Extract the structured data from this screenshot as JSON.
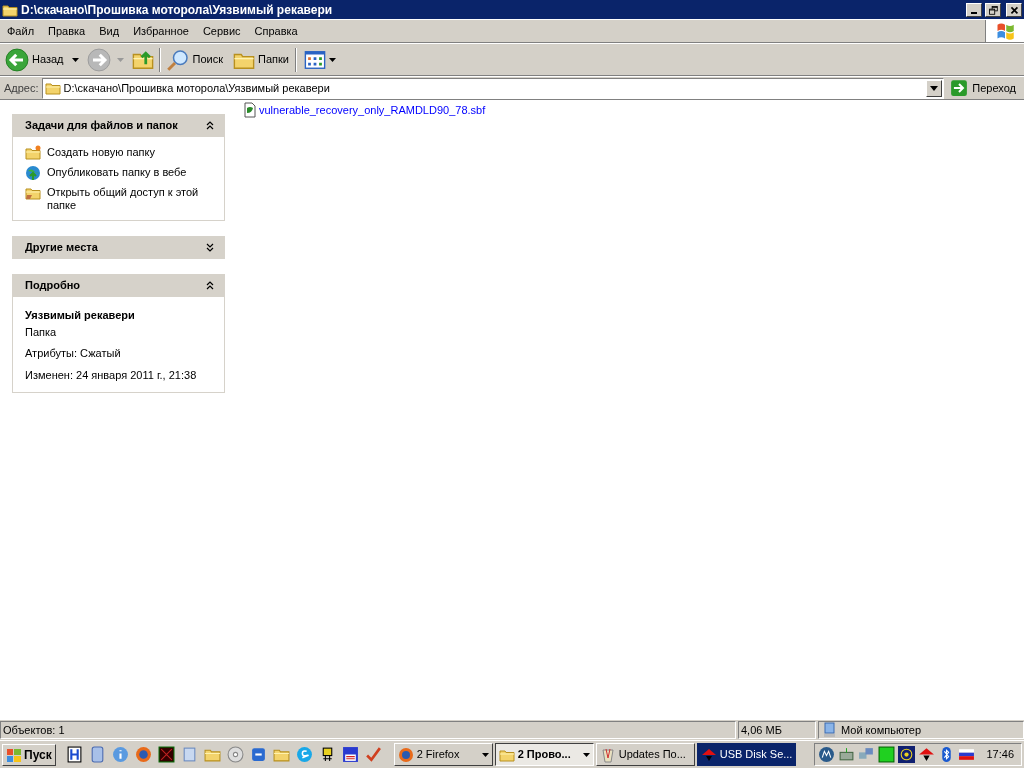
{
  "window": {
    "title": "D:\\скачано\\Прошивка моторола\\Уязвимый рекавери"
  },
  "menu": [
    "Файл",
    "Правка",
    "Вид",
    "Избранное",
    "Сервис",
    "Справка"
  ],
  "toolbar": {
    "back": {
      "label": "Назад",
      "disabled": false
    },
    "forward": {
      "disabled": true
    },
    "search": "Поиск",
    "folders": "Папки"
  },
  "address": {
    "label": "Адрес:",
    "value": "D:\\скачано\\Прошивка моторола\\Уязвимый рекавери",
    "go": "Переход"
  },
  "panels": [
    {
      "kind": "tasks",
      "title": "Задачи для файлов и папок",
      "expanded": true,
      "items": [
        "Создать новую папку",
        "Опубликовать папку в вебе",
        "Открыть общий доступ к этой папке"
      ]
    },
    {
      "kind": "places",
      "title": "Другие места",
      "expanded": false
    },
    {
      "kind": "details",
      "title": "Подробно",
      "expanded": true,
      "name": "Уязвимый рекавери",
      "type": "Папка",
      "lines": [
        "Атрибуты: Сжатый",
        "Изменен: 24 января 2011 г., 21:38"
      ]
    }
  ],
  "files": [
    "vulnerable_recovery_only_RAMDLD90_78.sbf"
  ],
  "status_bar": {
    "objects": "Объектов: 1",
    "size": "4,06 МБ",
    "zone": "Мой компьютер"
  },
  "taskbar": {
    "start": "Пуск",
    "buttons": [
      {
        "label": "2 Firefox",
        "selected": false,
        "flashing": false,
        "group": true
      },
      {
        "label": "2 Прово...",
        "selected": true,
        "flashing": false,
        "group": true
      },
      {
        "label": "Updates По...",
        "selected": false,
        "flashing": false,
        "group": false
      },
      {
        "label": "USB Disk Se...",
        "selected": false,
        "flashing": true,
        "group": false
      }
    ],
    "clock": "17:46"
  }
}
